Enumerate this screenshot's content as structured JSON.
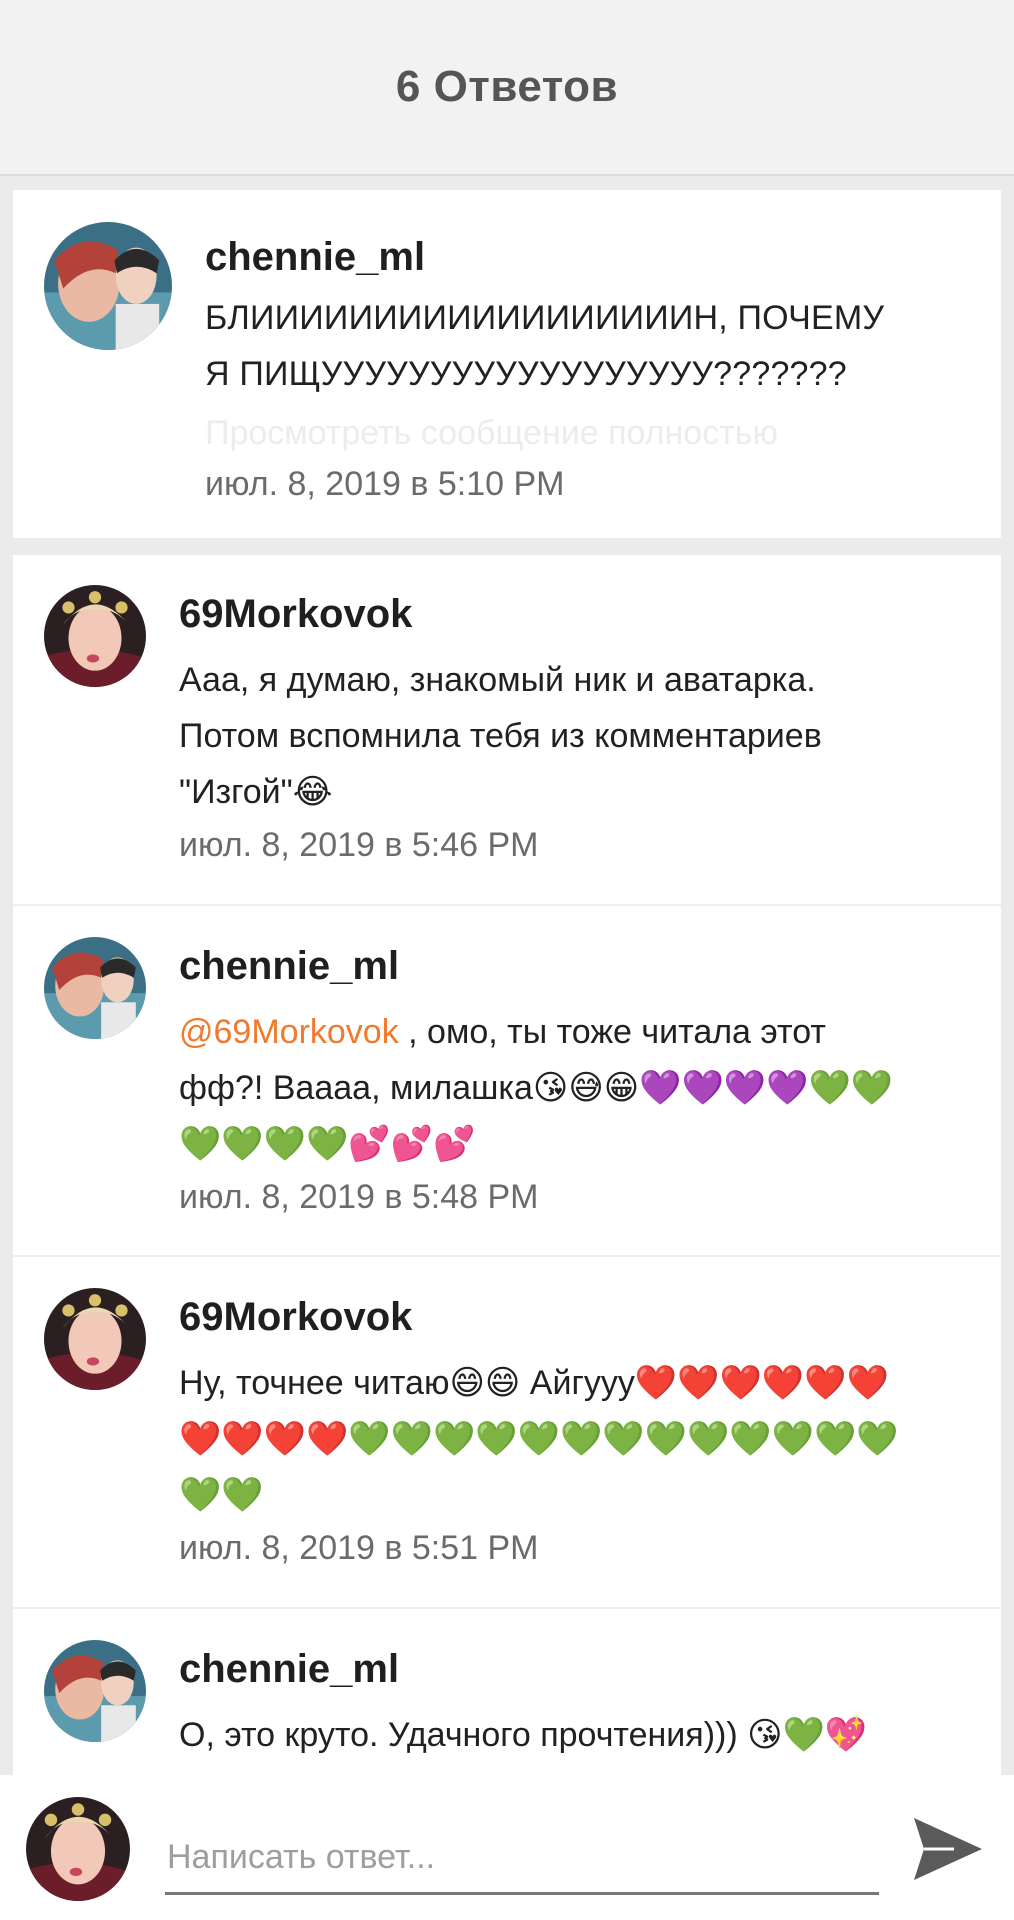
{
  "header": {
    "title": "6 Ответов"
  },
  "parent_comment": {
    "author": "chennie_ml",
    "text_line1": "БЛИИИИИИИИИИИИИИИИИИН, ПОЧЕМУ",
    "text_line2": "Я ПИЩУУУУУУУУУУУУУУУУУУ???????",
    "view_full_label": "Просмотреть сообщение полностью",
    "timestamp": "июл. 8, 2019 в 5:10 PM"
  },
  "replies": [
    {
      "author": "69Morkovok",
      "lines": [
        "Ааа, я думаю, знакомый ник и аватарка.",
        "Потом вспомнила тебя из комментариев",
        "\"Изгой\"😂"
      ],
      "timestamp": "июл. 8, 2019 в 5:46 PM"
    },
    {
      "author": "chennie_ml",
      "mention": "@69Morkovok",
      "line1_rest": " , омо, ты тоже читала этот",
      "line2": "фф?! Ваааа, милашка😘😅😁💜💜💜💜💚💚",
      "line3": "💚💚💚💚💕💕💕",
      "timestamp": "июл. 8, 2019 в 5:48 PM"
    },
    {
      "author": "69Morkovok",
      "lines": [
        "Ну, точнее читаю😄😄 Айгууу❤️❤️❤️❤️❤️❤️",
        "❤️❤️❤️❤️💚💚💚💚💚💚💚💚💚💚💚💚💚",
        "💚💚"
      ],
      "timestamp": "июл. 8, 2019 в 5:51 PM"
    },
    {
      "author": "chennie_ml",
      "lines": [
        "О, это круто. Удачного прочтения))) 😘💚💖"
      ]
    }
  ],
  "reply_bar": {
    "placeholder": "Написать ответ..."
  },
  "icons": {
    "send": "send-arrow-icon",
    "avatar_chennie": "avatar-photo",
    "avatar_morkovok": "avatar-photo"
  },
  "colors": {
    "mention": "#f07a2e",
    "timestamp": "#6b6b6b"
  }
}
